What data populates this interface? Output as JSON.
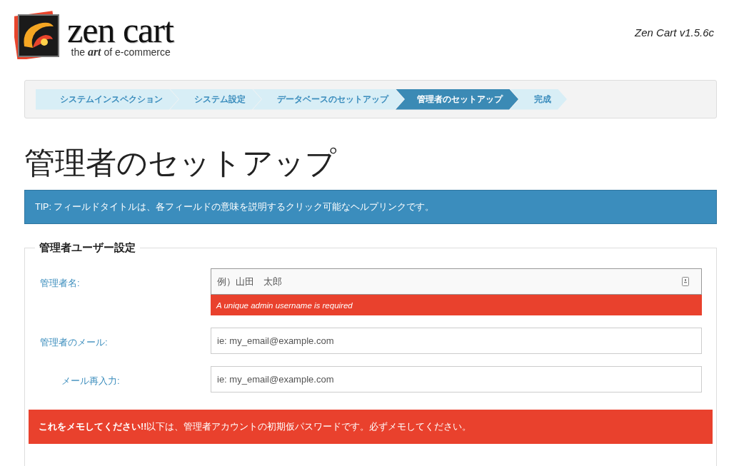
{
  "header": {
    "logo_name": "zen cart",
    "logo_tagline": "the **art** of e-commerce",
    "version": "Zen Cart v1.5.6c"
  },
  "steps": [
    {
      "label": "システムインスペクション",
      "selected": false
    },
    {
      "label": "システム設定",
      "selected": false
    },
    {
      "label": "データベースのセットアップ",
      "selected": false
    },
    {
      "label": "管理者のセットアップ",
      "selected": true
    },
    {
      "label": "完成",
      "selected": false
    }
  ],
  "page_title": "管理者のセットアップ",
  "tip": "TIP: フィールドタイトルは、各フィールドの意味を説明するクリック可能なヘルプリンクです。",
  "fieldset": {
    "legend": "管理者ユーザー設定",
    "fields": [
      {
        "label": "管理者名:",
        "placeholder": "例）山田　太郎",
        "focused": true,
        "error": "A unique admin username is required",
        "indented": false
      },
      {
        "label": "管理者のメール:",
        "placeholder": "ie: my_email@example.com",
        "focused": false,
        "indented": false
      },
      {
        "label": "メール再入力:",
        "placeholder": "ie: my_email@example.com",
        "focused": false,
        "indented": true
      }
    ]
  },
  "alert": "**これをメモしてください!!**以下は、管理者アカウントの初期仮パスワードです。必ずメモしてください。"
}
